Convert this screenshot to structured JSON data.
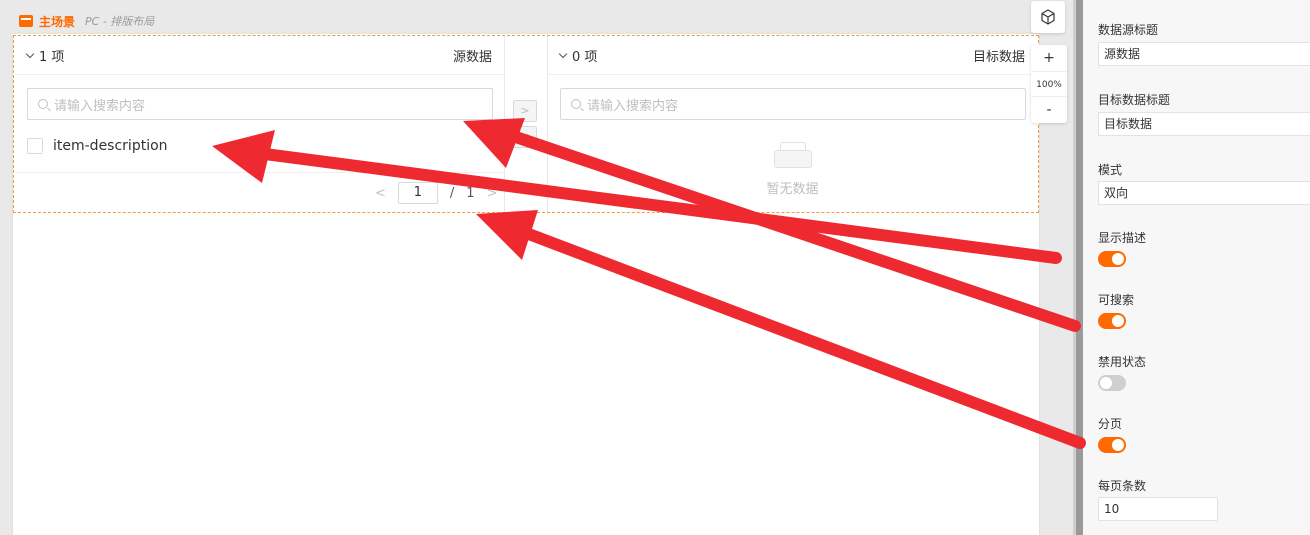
{
  "scene": {
    "title": "主场景",
    "subtitle": "PC - 排版布局"
  },
  "transfer": {
    "source": {
      "count_label": "1 项",
      "title": "源数据",
      "search_placeholder": "请输入搜索内容",
      "items": [
        {
          "label": "item-description",
          "checked": false
        }
      ],
      "pager": {
        "current": "1",
        "separator": "/",
        "total": "1"
      }
    },
    "target": {
      "count_label": "0 项",
      "title": "目标数据",
      "search_placeholder": "请输入搜索内容",
      "empty_text": "暂无数据"
    },
    "move_right_label": ">",
    "move_left_label": "<"
  },
  "zoom": {
    "plus": "+",
    "level": "100%",
    "minus": "-",
    "cube_icon": "cube-icon"
  },
  "settings": {
    "source_title_label": "数据源标题",
    "source_title_value": "源数据",
    "target_title_label": "目标数据标题",
    "target_title_value": "目标数据",
    "mode_label": "模式",
    "mode_value": "双向",
    "show_desc_label": "显示描述",
    "show_desc_on": true,
    "searchable_label": "可搜索",
    "searchable_on": true,
    "disabled_label": "禁用状态",
    "disabled_on": false,
    "pagination_label": "分页",
    "pagination_on": true,
    "page_size_label": "每页条数",
    "page_size_value": "10"
  },
  "colors": {
    "accent": "#ff6a00",
    "arrow": "#ee2a30"
  }
}
